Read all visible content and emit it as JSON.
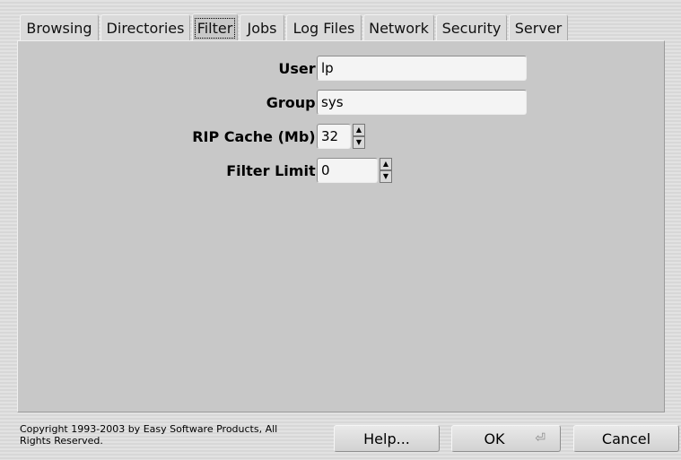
{
  "tabs": [
    {
      "label": "Browsing"
    },
    {
      "label": "Directories"
    },
    {
      "label": "Filter"
    },
    {
      "label": "Jobs"
    },
    {
      "label": "Log Files"
    },
    {
      "label": "Network"
    },
    {
      "label": "Security"
    },
    {
      "label": "Server"
    }
  ],
  "active_tab": "Filter",
  "form": {
    "user": {
      "label": "User:",
      "value": "lp"
    },
    "group": {
      "label": "Group:",
      "value": "sys"
    },
    "rip_cache": {
      "label": "RIP Cache (Mb):",
      "value": "32"
    },
    "filter_limit": {
      "label": "Filter Limit:",
      "value": "0"
    }
  },
  "footer": {
    "copyright": "Copyright 1993-2003 by Easy Software Products, All Rights Reserved.",
    "help_label": "Help...",
    "ok_label": "OK",
    "cancel_label": "Cancel"
  },
  "icons": {
    "spin_up": "up-arrow-icon",
    "spin_down": "down-arrow-icon",
    "ok_shortcut": "return-key-icon"
  }
}
